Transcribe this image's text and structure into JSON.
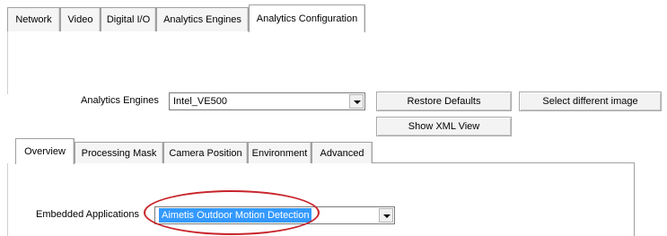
{
  "top_tabs": [
    {
      "label": "Network"
    },
    {
      "label": "Video"
    },
    {
      "label": "Digital I/O"
    },
    {
      "label": "Analytics Engines"
    },
    {
      "label": "Analytics Configuration",
      "active": true
    }
  ],
  "engine_row": {
    "label": "Analytics Engines",
    "selected": "Intel_VE500",
    "restore_defaults": "Restore Defaults",
    "select_image": "Select different image",
    "show_xml": "Show XML View"
  },
  "sub_tabs": [
    {
      "label": "Overview",
      "active": true
    },
    {
      "label": "Processing Mask"
    },
    {
      "label": "Camera Position"
    },
    {
      "label": "Environment"
    },
    {
      "label": "Advanced"
    }
  ],
  "embedded": {
    "label": "Embedded Applications",
    "selected": "Aimetis Outdoor Motion Detection"
  },
  "colors": {
    "selection_highlight": "#3399ff",
    "annotation_circle": "#c8242a"
  }
}
